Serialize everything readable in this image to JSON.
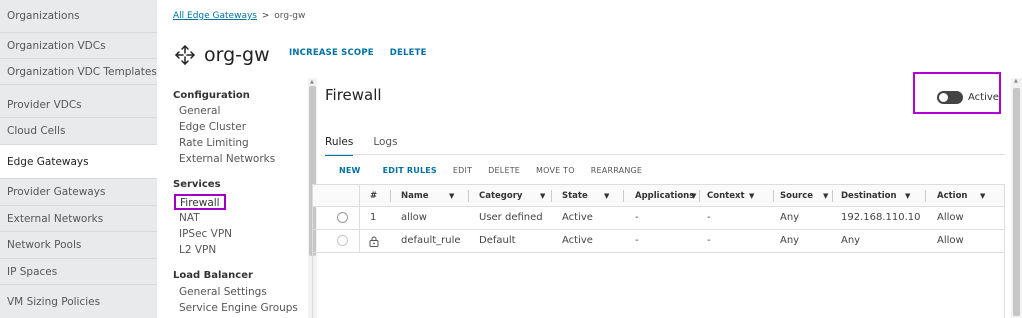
{
  "leftnav": {
    "items": [
      {
        "label": "Organizations"
      },
      {
        "label": "Organization VDCs"
      },
      {
        "label": "Organization VDC Templates"
      },
      {
        "label": "Provider VDCs"
      },
      {
        "label": "Cloud Cells"
      },
      {
        "label": "Edge Gateways",
        "active": true
      },
      {
        "label": "Provider Gateways"
      },
      {
        "label": "External Networks"
      },
      {
        "label": "Network Pools"
      },
      {
        "label": "IP Spaces"
      },
      {
        "label": "VM Sizing Policies"
      }
    ]
  },
  "breadcrumb": {
    "parent": "All Edge Gateways",
    "separator": ">",
    "current": "org-gw"
  },
  "header": {
    "title": "org-gw",
    "actions": [
      "INCREASE SCOPE",
      "DELETE"
    ]
  },
  "services_nav": {
    "configuration": {
      "heading": "Configuration",
      "items": [
        "General",
        "Edge Cluster",
        "Rate Limiting",
        "External Networks"
      ]
    },
    "services": {
      "heading": "Services",
      "items": [
        "Firewall",
        "NAT",
        "IPSec VPN",
        "L2 VPN"
      ],
      "selected": "Firewall"
    },
    "load_balancer": {
      "heading": "Load Balancer",
      "items": [
        "General Settings",
        "Service Engine Groups"
      ]
    }
  },
  "main": {
    "title": "Firewall",
    "toggle": {
      "label": "Active",
      "state": "on"
    },
    "tabs": [
      {
        "label": "Rules",
        "active": true
      },
      {
        "label": "Logs"
      }
    ],
    "toolbar": {
      "new": "NEW",
      "edit_rules": "EDIT RULES",
      "edit": "EDIT",
      "delete": "DELETE",
      "move_to": "MOVE TO",
      "rearrange": "REARRANGE"
    },
    "table": {
      "columns": [
        "#",
        "Name",
        "Category",
        "State",
        "Applications",
        "Context",
        "Source",
        "Destination",
        "Action"
      ],
      "rows": [
        {
          "num": "1",
          "name": "allow",
          "category": "User defined",
          "state": "Active",
          "applications": "-",
          "context": "-",
          "source": "Any",
          "destination": "192.168.110.10",
          "action": "Allow"
        },
        {
          "num": "",
          "name": "default_rule",
          "category": "Default",
          "state": "Active",
          "applications": "-",
          "context": "-",
          "source": "Any",
          "destination": "Any",
          "action": "Allow",
          "locked": true
        }
      ]
    }
  },
  "colors": {
    "accent": "#0072a3",
    "highlight": "#a100c8",
    "nav_bg": "#e8eaec"
  }
}
